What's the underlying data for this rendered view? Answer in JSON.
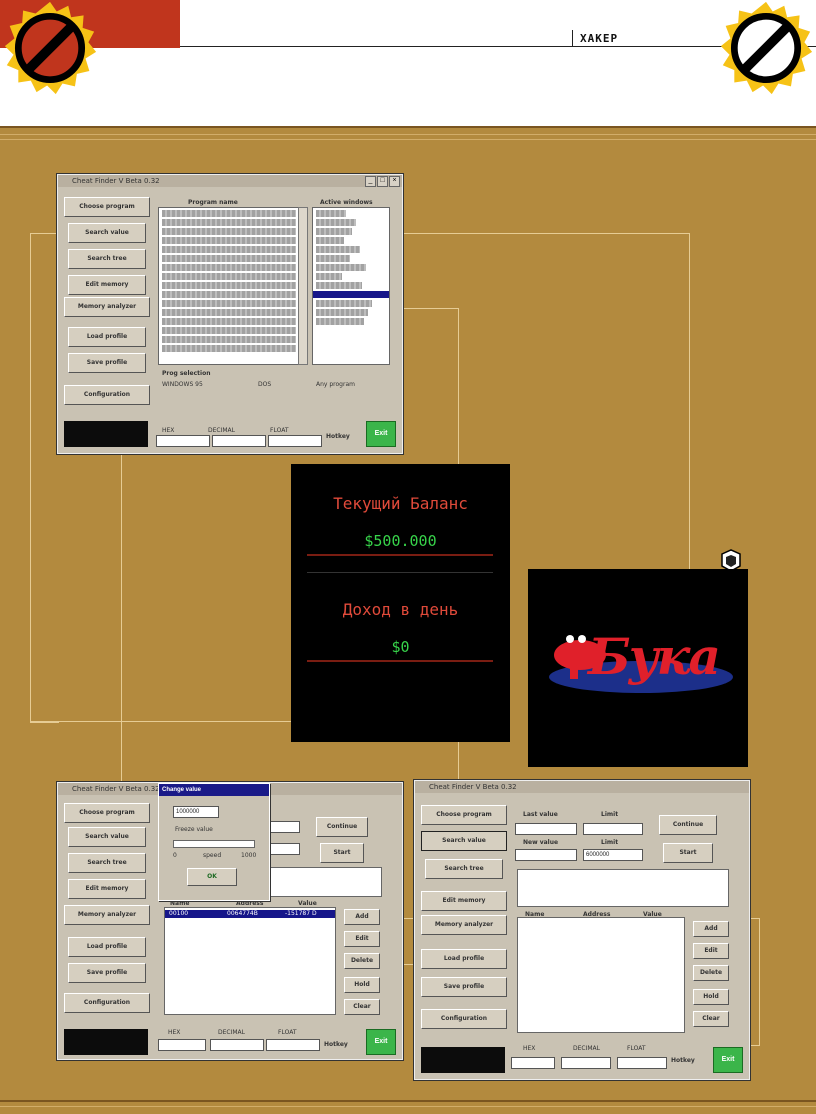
{
  "header": {
    "logo_text": "ХАКЕР"
  },
  "window_main": {
    "title": "Cheat Finder V Beta 0.32",
    "program_list_header": "Program name",
    "action_list_header": "Active windows",
    "side_buttons": [
      "Choose program",
      "Search value",
      "Search tree",
      "Edit memory",
      "Memory analyzer",
      "Load profile",
      "Save profile",
      "Configuration"
    ],
    "prog_selection_label": "Prog selection",
    "radio_options": [
      "WINDOWS 95",
      "DOS",
      "Any program"
    ],
    "bottom_labels": [
      "HEX",
      "DECIMAL",
      "FLOAT"
    ],
    "hotkey_label": "Hotkey",
    "exit_label": "Exit"
  },
  "balance_box": {
    "title1": "Текущий Баланс",
    "value1": "$500.000",
    "title2": "Доход в день",
    "value2": "$0"
  },
  "buka": {
    "logo_text": "Бука"
  },
  "window_change": {
    "title": "Cheat Finder V Beta 0.32",
    "dialog_title": "Change value",
    "dialog_value": "1000000",
    "dialog_checkbox": "Freeze value",
    "dialog_slow": "0",
    "dialog_speed": "speed",
    "dialog_fast": "1000",
    "dialog_ok": "OK",
    "continue_label": "Continue",
    "start_label": "Start",
    "list_headers": [
      "Name",
      "Address",
      "Value"
    ],
    "list_row": [
      "00100",
      "0064774B",
      "-151787  D"
    ],
    "right_buttons": [
      "Add",
      "Edit",
      "Delete",
      "Hold",
      "Clear"
    ]
  },
  "window_search": {
    "title": "Cheat Finder V Beta 0.32",
    "last_value_label": "Last value",
    "last_value_limit": "Limit",
    "new_value_label": "New value",
    "new_value_limit": "Limit",
    "new_value": "6000000",
    "continue_label": "Continue",
    "start_label": "Start",
    "list_headers": [
      "Name",
      "Address",
      "Value"
    ],
    "right_buttons": [
      "Add",
      "Edit",
      "Delete",
      "Hold",
      "Clear"
    ]
  }
}
